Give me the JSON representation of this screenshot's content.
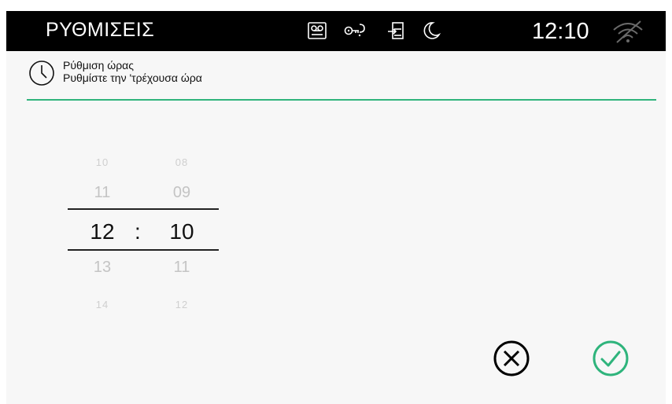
{
  "topbar": {
    "title": "ΡΥΘΜΙΣΕΙΣ",
    "time": "12:10",
    "status_icons": [
      "voicemail-icon",
      "key-icon",
      "door-exit-icon",
      "moon-icon"
    ],
    "wifi_icon": "wifi-off-icon"
  },
  "header": {
    "title": "Ρύθμιση ώρας",
    "subtitle": "Ρυθμίστε την 'τρέχουσα ώρα",
    "icon": "clock-icon"
  },
  "picker": {
    "hours": {
      "far_above": "10",
      "above": "11",
      "selected": "12",
      "below": "13",
      "far_below": "14"
    },
    "separator": ":",
    "minutes": {
      "far_above": "08",
      "above": "09",
      "selected": "10",
      "below": "11",
      "far_below": "12"
    }
  },
  "actions": {
    "cancel_icon": "cancel-icon",
    "confirm_icon": "confirm-icon"
  },
  "colors": {
    "accent": "#2fb47c",
    "topbar_bg": "#000000",
    "screen_bg": "#f7f7f7"
  }
}
